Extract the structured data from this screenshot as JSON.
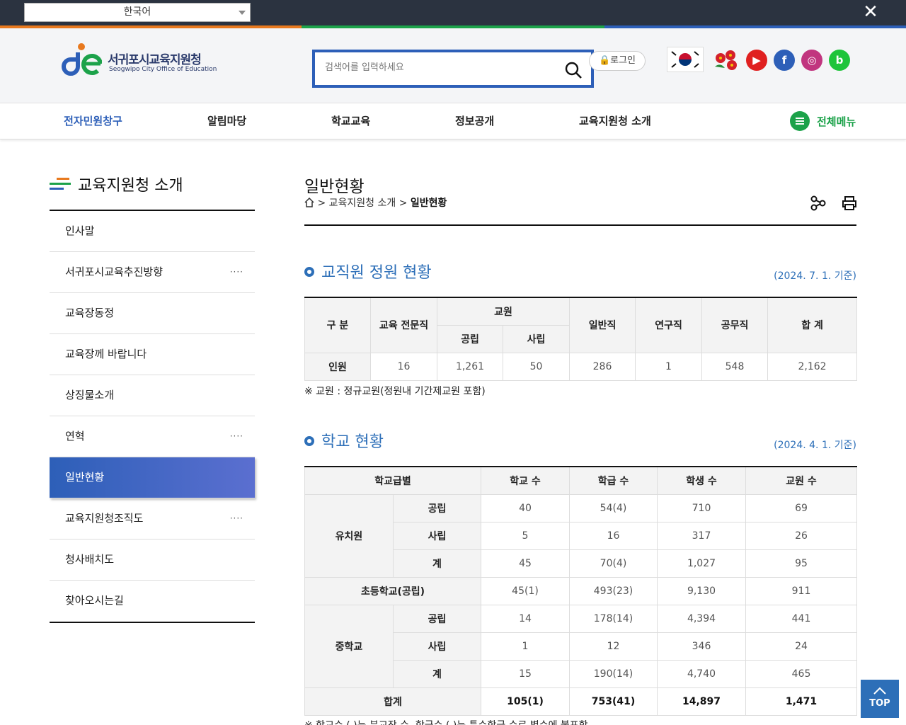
{
  "topbar": {
    "language": "한국어",
    "close": "✕"
  },
  "header": {
    "logo_kr": "서귀포시교육지원청",
    "logo_en": "Seogwipo City Office of Education",
    "search_placeholder": "검색어를 입력하세요",
    "login_label": "로그인",
    "sns": {
      "youtube": "▶",
      "facebook": "f",
      "instagram": "◎",
      "blog": "b"
    }
  },
  "gnb": {
    "items": [
      "전자민원창구",
      "알림마당",
      "학교교육",
      "정보공개",
      "교육지원청 소개"
    ],
    "all_menu": "전체메뉴"
  },
  "lnb": {
    "title": "교육지원청 소개",
    "items": [
      {
        "label": "인사말",
        "more": ""
      },
      {
        "label": "서귀포시교육추진방향",
        "more": "····"
      },
      {
        "label": "교육장동정",
        "more": ""
      },
      {
        "label": "교육장께 바랍니다",
        "more": ""
      },
      {
        "label": "상징물소개",
        "more": ""
      },
      {
        "label": "연혁",
        "more": "····"
      },
      {
        "label": "일반현황",
        "more": ""
      },
      {
        "label": "교육지원청조직도",
        "more": "····"
      },
      {
        "label": "청사배치도",
        "more": ""
      },
      {
        "label": "찾아오시는길",
        "more": ""
      }
    ]
  },
  "content": {
    "page_title": "일반현황",
    "breadcrumb": {
      "sep": ">",
      "parent": "교육지원청 소개",
      "current": "일반현황"
    },
    "staff": {
      "title": "교직원 정원 현황",
      "date": "(2024. 7. 1. 기준)",
      "headers": {
        "category": "구 분",
        "specialist": "교육 전문직",
        "teacher": "교원",
        "public": "공립",
        "private": "사립",
        "general": "일반직",
        "research": "연구직",
        "civil": "공무직",
        "total": "합 계"
      },
      "row": {
        "label": "인원",
        "specialist": "16",
        "public": "1,261",
        "private": "50",
        "general": "286",
        "research": "1",
        "civil": "548",
        "total": "2,162"
      },
      "note": "※ 교원 : 정규교원(정원내 기간제교원 포함)"
    },
    "school": {
      "title": "학교 현황",
      "date": "(2024. 4. 1. 기준)",
      "headers": {
        "level": "학교급별",
        "schools": "학교 수",
        "classes": "학급 수",
        "students": "학생 수",
        "teachers": "교원 수"
      },
      "kinder": {
        "label": "유치원",
        "rows": [
          {
            "type": "공립",
            "schools": "40",
            "classes": "54(4)",
            "students": "710",
            "teachers": "69"
          },
          {
            "type": "사립",
            "schools": "5",
            "classes": "16",
            "students": "317",
            "teachers": "26"
          },
          {
            "type": "계",
            "schools": "45",
            "classes": "70(4)",
            "students": "1,027",
            "teachers": "95"
          }
        ]
      },
      "elementary": {
        "label": "초등학교(공립)",
        "schools": "45(1)",
        "classes": "493(23)",
        "students": "9,130",
        "teachers": "911"
      },
      "middle": {
        "label": "중학교",
        "rows": [
          {
            "type": "공립",
            "schools": "14",
            "classes": "178(14)",
            "students": "4,394",
            "teachers": "441"
          },
          {
            "type": "사립",
            "schools": "1",
            "classes": "12",
            "students": "346",
            "teachers": "24"
          },
          {
            "type": "계",
            "schools": "15",
            "classes": "190(14)",
            "students": "4,740",
            "teachers": "465"
          }
        ]
      },
      "total": {
        "label": "합계",
        "schools": "105(1)",
        "classes": "753(41)",
        "students": "14,897",
        "teachers": "1,471"
      },
      "note": "※ 학교수 ( )는 분교장 수, 학급수 ( )는 특수학급 수로 별수에 불포함"
    }
  },
  "top_button": "TOP"
}
